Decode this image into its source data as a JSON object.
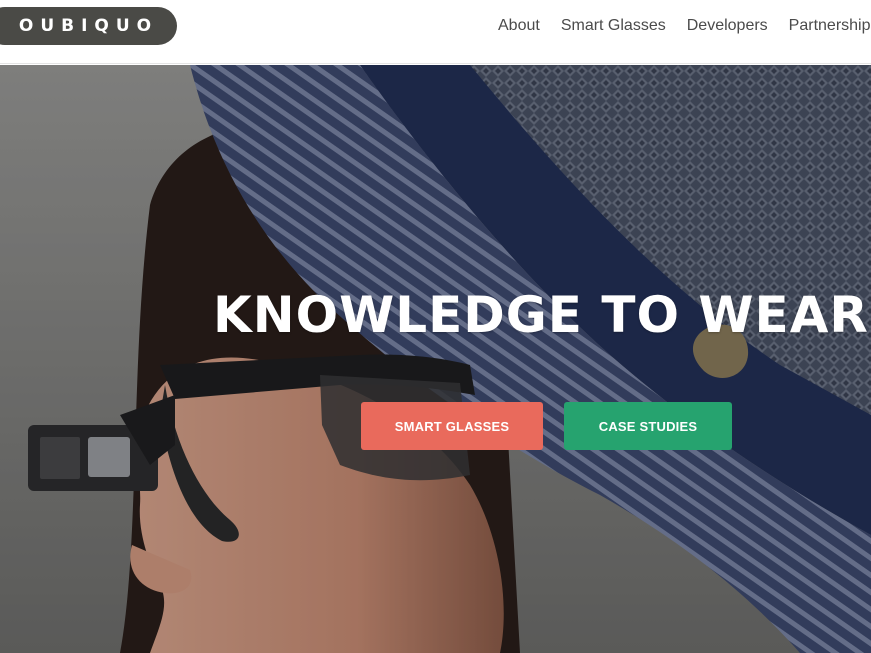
{
  "header": {
    "logo_text": "OUBIQUO",
    "nav": [
      {
        "label": "About"
      },
      {
        "label": "Smart Glasses"
      },
      {
        "label": "Developers"
      },
      {
        "label": "Partnerships"
      }
    ]
  },
  "hero": {
    "headline": "KNOWLEDGE TO WEAR",
    "buttons": {
      "primary": "SMART GLASSES",
      "secondary": "CASE STUDIES"
    },
    "image_description": "woman-wearing-smart-glasses-and-blue-hat"
  },
  "colors": {
    "logo_background": "#4a4a46",
    "nav_text": "#4b4b4b",
    "button_primary": "#e96a5c",
    "button_secondary": "#26a36f",
    "headline": "#ffffff"
  }
}
